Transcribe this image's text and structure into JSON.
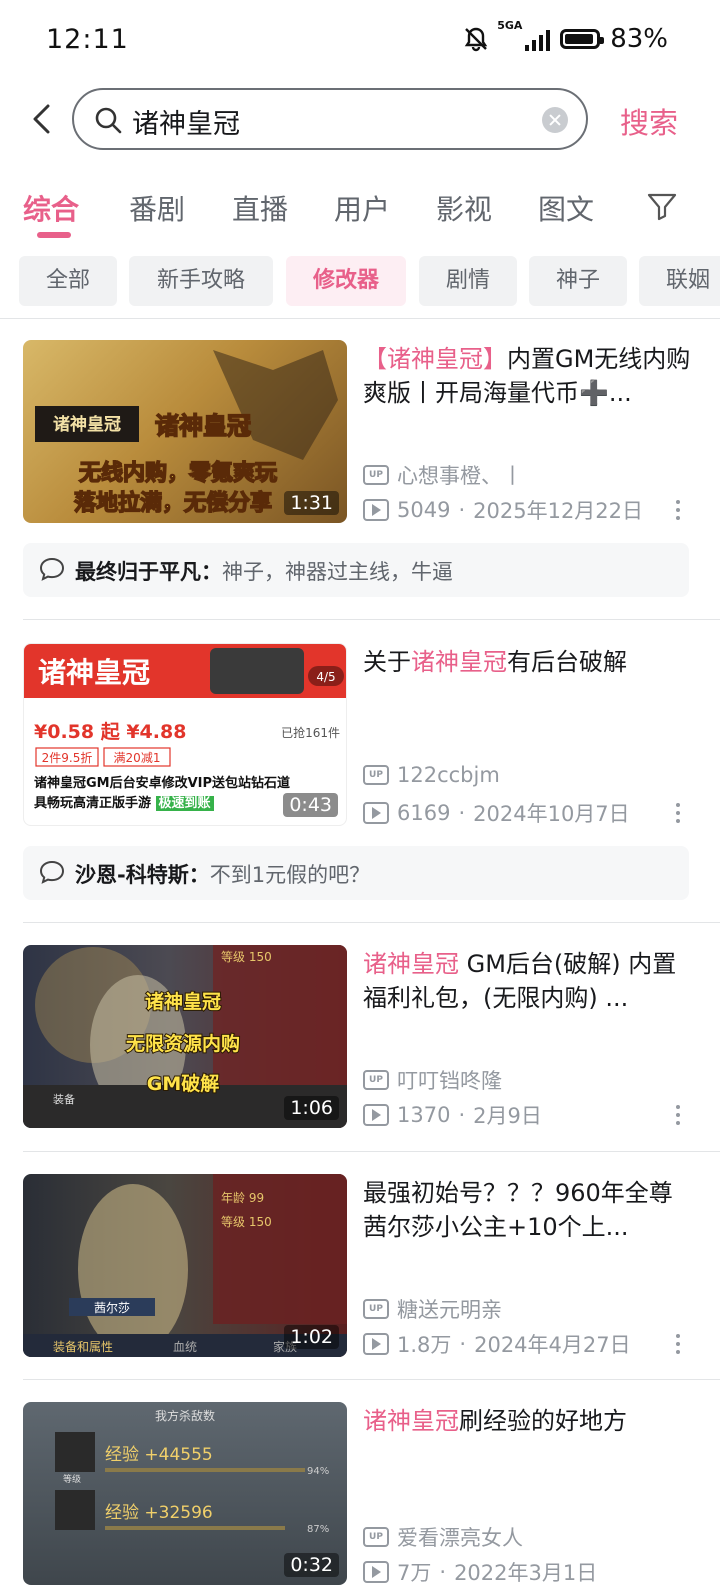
{
  "status_bar": {
    "time": "12:11",
    "network": "5GA",
    "battery": "83%"
  },
  "search": {
    "query": "诸神皇冠",
    "button": "搜索"
  },
  "tabs": [
    "综合",
    "番剧",
    "直播",
    "用户",
    "影视",
    "图文"
  ],
  "chips": [
    "全部",
    "新手攻略",
    "修改器",
    "剧情",
    "神子",
    "联姻"
  ],
  "colors": {
    "accent": "#e8608a",
    "muted": "#9499a0"
  },
  "results": [
    {
      "title_hl": "【诸神皇冠】",
      "title_rest": "内置GM无线内购爽版丨开局海量代币➕...",
      "thumb_text": [
        "诸神皇冠",
        "无线内购，零氪爽玩",
        "落地拉满，无偿分享"
      ],
      "duration": "1:31",
      "author": "心想事橙、丨",
      "views": "5049",
      "date": "2025年12月22日",
      "comment_user": "最终归于平凡：",
      "comment_text": "神子，神器过主线，牛逼"
    },
    {
      "title_pre": "关于",
      "title_hl": "诸神皇冠",
      "title_rest": "有后台破解",
      "thumb_text": [
        "诸神皇冠",
        "4/5",
        "¥0.58 起 ¥4.88",
        "已抢161件",
        "2件9.5折",
        "满20减1",
        "诸神皇冠GM后台安卓修改VIP送包站钻石道具畅玩高清正版手游",
        "极速到账"
      ],
      "duration": "0:43",
      "author": "122ccbjm",
      "views": "6169",
      "date": "2024年10月7日",
      "comment_user": "沙恩-科特斯：",
      "comment_text": "不到1元假的吧？"
    },
    {
      "title_hl": "诸神皇冠",
      "title_rest": " GM后台(破解) 内置福利礼包，(无限内购) ...",
      "thumb_text": [
        "诸神皇冠",
        "无限资源内购",
        "GM破解",
        "等级 150",
        "装备"
      ],
      "duration": "1:06",
      "author": "叮叮铛咚隆",
      "views": "1370",
      "date": "2月9日"
    },
    {
      "title_rest": "最强初始号？？？960年全尊茜尔莎小公主+10个上...",
      "thumb_text": [
        "年龄 99",
        "等级 150",
        "茜尔莎",
        "装备和属性",
        "血统",
        "家族"
      ],
      "duration": "1:02",
      "author": "糖送元明亲",
      "views": "1.8万",
      "date": "2024年4月27日"
    },
    {
      "title_hl": "诸神皇冠",
      "title_rest": "刷经验的好地方",
      "thumb_text": [
        "我方杀敌数",
        "经验 +44555",
        "经验 +32596",
        "等级",
        "94%",
        "87%"
      ],
      "duration": "0:32",
      "author": "爱看漂亮女人",
      "views": "7万",
      "date": "2022年3月1日"
    }
  ]
}
